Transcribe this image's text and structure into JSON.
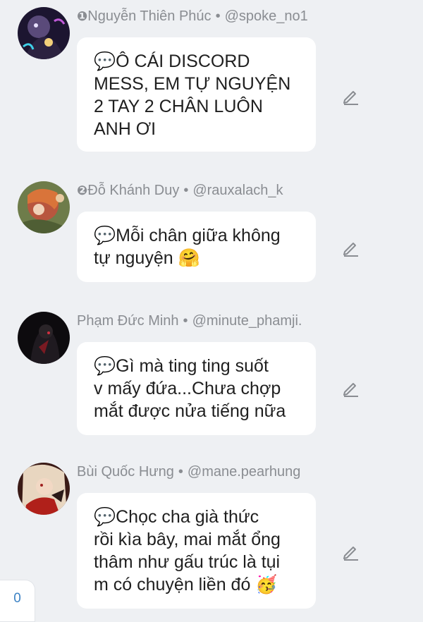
{
  "comments": [
    {
      "rank": "❶",
      "name": "Nguyễn Thiên Phúc",
      "sep": "•",
      "handle": "@spoke_no1",
      "lines": [
        "💬Ô CÁI DISCORD",
        "MESS, EM TỰ NGUYỆN",
        "2 TAY 2 CHÂN LUÔN",
        "ANH ƠI"
      ]
    },
    {
      "rank": "❷",
      "name": "Đỗ Khánh Duy",
      "sep": "•",
      "handle": "@rauxalach_k",
      "lines": [
        "💬Mỗi chân giữa không",
        "tự nguyện 🤗"
      ]
    },
    {
      "rank": "",
      "name": "Phạm Đức Minh",
      "sep": "•",
      "handle": "@minute_phamji.",
      "lines": [
        "💬Gì mà ting ting suốt",
        "v mấy đứa...Chưa chợp",
        "mắt được nửa tiếng nữa"
      ]
    },
    {
      "rank": "",
      "name": "Bùi Quốc Hưng",
      "sep": "•",
      "handle": "@mane.pearhung",
      "lines": [
        "💬Chọc cha già thức",
        "rồi kìa bây, mai mắt ổng",
        "thâm như gấu trúc là tụi",
        "m có chuyện liền đó 🥳"
      ]
    }
  ],
  "edit_icon": "pencil-edit-icon",
  "counter": "0",
  "colors": {
    "background": "#eef0f3",
    "bubble": "#ffffff",
    "meta_text": "#8a8d92",
    "body_text": "#1f1f1f",
    "counter_text": "#3b82c4"
  }
}
